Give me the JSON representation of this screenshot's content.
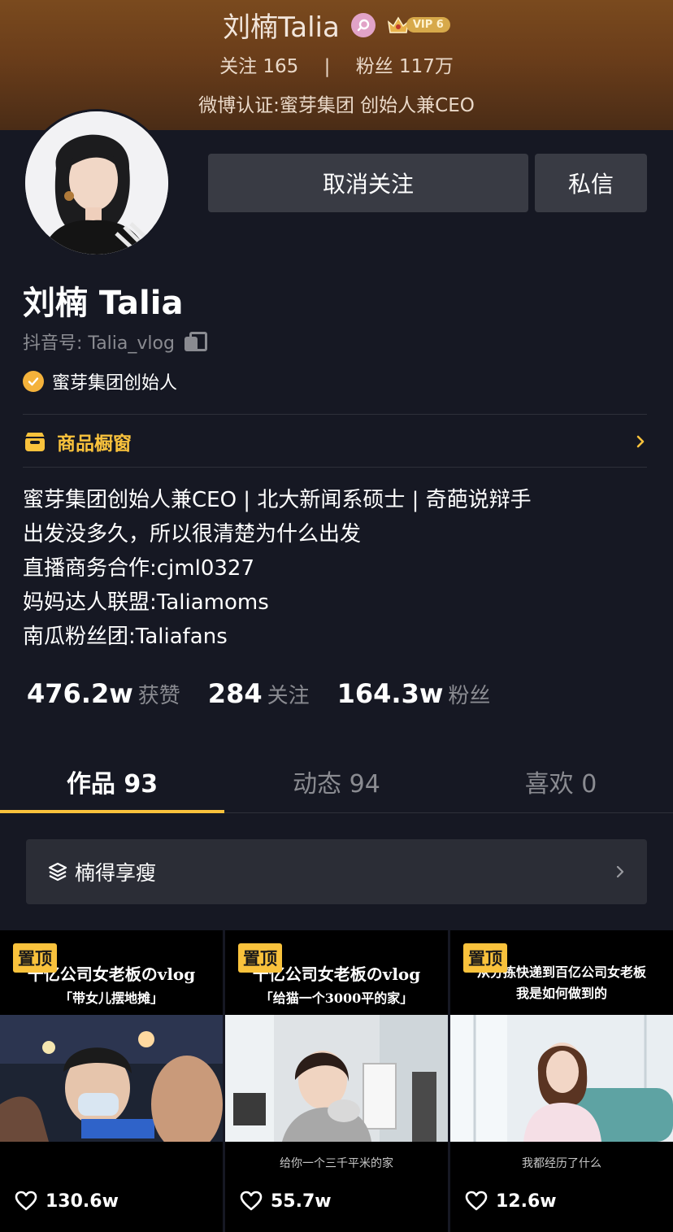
{
  "banner": {
    "name": "刘楠Talia",
    "vip_label": "VIP 6",
    "following": "关注 165",
    "separator": "|",
    "followers": "粉丝 117万",
    "verification": "微博认证:蜜芽集团 创始人兼CEO"
  },
  "actions": {
    "unfollow_label": "取消关注",
    "message_label": "私信"
  },
  "profile": {
    "name": "刘楠 Talia",
    "douyin_id": "抖音号: Talia_vlog",
    "verified_title": "蜜芽集团创始人"
  },
  "shop": {
    "label": "商品橱窗"
  },
  "bio": [
    "蜜芽集团创始人兼CEO | 北大新闻系硕士 | 奇葩说辩手",
    "出发没多久，所以很清楚为什么出发",
    "直播商务合作:cjml0327",
    "妈妈达人联盟:Taliamoms",
    "南瓜粉丝团:Taliafans"
  ],
  "stats": [
    {
      "value": "476.2w",
      "label": "获赞"
    },
    {
      "value": "284",
      "label": "关注"
    },
    {
      "value": "164.3w",
      "label": "粉丝"
    }
  ],
  "tabs": [
    {
      "label": "作品 93",
      "active": true
    },
    {
      "label": "动态 94",
      "active": false
    },
    {
      "label": "喜欢 0",
      "active": false
    }
  ],
  "collection": {
    "label": "楠得享瘦"
  },
  "videos": [
    {
      "pin": "置顶",
      "title": "十亿公司女老板のvlog",
      "subtitle": "「带女儿摆地摊」",
      "caption": "",
      "likes": "130.6w"
    },
    {
      "pin": "置顶",
      "title": "十亿公司女老板のvlog",
      "subtitle": "「给猫一个3000平的家」",
      "caption": "给你一个三千平米的家",
      "likes": "55.7w"
    },
    {
      "pin": "置顶",
      "title": "从分拣快递到百亿公司女老板",
      "subtitle": "我是如何做到的",
      "caption": "我都经历了什么",
      "likes": "12.6w"
    }
  ],
  "colors": {
    "background": "#161823",
    "accent_yellow": "#f9c23c",
    "button_bg": "#393b44",
    "muted_text": "#8a8b91"
  }
}
